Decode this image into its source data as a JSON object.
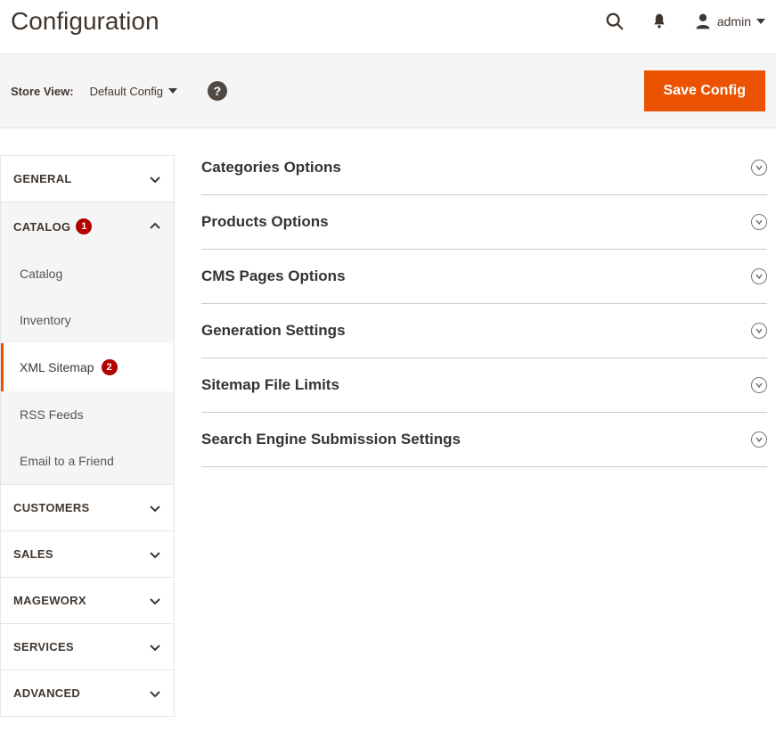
{
  "header": {
    "title": "Configuration",
    "admin_label": "admin"
  },
  "toolbar": {
    "store_view_label": "Store View:",
    "store_view_value": "Default Config",
    "save_label": "Save Config"
  },
  "sidebar": {
    "groups": [
      {
        "id": "general",
        "label": "GENERAL",
        "expanded": false,
        "badge": null,
        "items": []
      },
      {
        "id": "catalog",
        "label": "CATALOG",
        "expanded": true,
        "badge": "1",
        "items": [
          {
            "id": "catalog-sub",
            "label": "Catalog",
            "active": false,
            "badge": null
          },
          {
            "id": "inventory",
            "label": "Inventory",
            "active": false,
            "badge": null
          },
          {
            "id": "xml-sitemap",
            "label": "XML Sitemap",
            "active": true,
            "badge": "2"
          },
          {
            "id": "rss-feeds",
            "label": "RSS Feeds",
            "active": false,
            "badge": null
          },
          {
            "id": "email-friend",
            "label": "Email to a Friend",
            "active": false,
            "badge": null
          }
        ]
      },
      {
        "id": "customers",
        "label": "CUSTOMERS",
        "expanded": false,
        "badge": null,
        "items": []
      },
      {
        "id": "sales",
        "label": "SALES",
        "expanded": false,
        "badge": null,
        "items": []
      },
      {
        "id": "mageworx",
        "label": "MAGEWORX",
        "expanded": false,
        "badge": null,
        "items": []
      },
      {
        "id": "services",
        "label": "SERVICES",
        "expanded": false,
        "badge": null,
        "items": []
      },
      {
        "id": "advanced",
        "label": "ADVANCED",
        "expanded": false,
        "badge": null,
        "items": []
      }
    ]
  },
  "main": {
    "sections": [
      {
        "id": "categories",
        "title": "Categories Options"
      },
      {
        "id": "products",
        "title": "Products Options"
      },
      {
        "id": "cms",
        "title": "CMS Pages Options"
      },
      {
        "id": "generation",
        "title": "Generation Settings"
      },
      {
        "id": "filelimits",
        "title": "Sitemap File Limits"
      },
      {
        "id": "searcheng",
        "title": "Search Engine Submission Settings"
      }
    ]
  }
}
